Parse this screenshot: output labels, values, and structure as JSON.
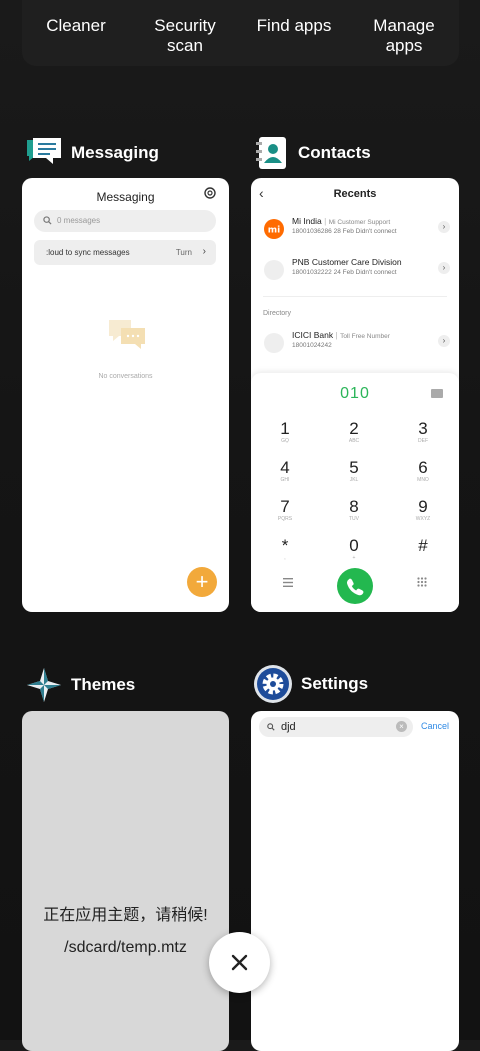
{
  "quick_actions": [
    {
      "label_1": "Cleaner",
      "label_2": ""
    },
    {
      "label_1": "Security",
      "label_2": "scan"
    },
    {
      "label_1": "Find apps",
      "label_2": ""
    },
    {
      "label_1": "Manage",
      "label_2": "apps"
    }
  ],
  "apps": {
    "messaging": {
      "name": "Messaging",
      "screen_title": "Messaging",
      "search_placeholder": "0 messages",
      "sync_text": ":loud to sync messages",
      "sync_action": "Turn",
      "empty_text": "No conversations",
      "fab_label": "+"
    },
    "contacts": {
      "name": "Contacts",
      "back": "‹",
      "screen_title": "Recents",
      "recents": [
        {
          "name": "Mi India",
          "tag": "Mi Customer Support",
          "number": "18001036286",
          "meta": "28 Feb Didn't connect"
        },
        {
          "name": "PNB Customer Care Division",
          "tag": "",
          "number": "18001032222",
          "meta": "24 Feb Didn't connect"
        }
      ],
      "directory_label": "Directory",
      "directory": [
        {
          "name": "ICICI Bank",
          "tag": "Toll Free Number",
          "number": "18001024242"
        }
      ],
      "dial_input": "010",
      "keys": [
        {
          "d": "1",
          "l": "GǪ"
        },
        {
          "d": "2",
          "l": "ABC"
        },
        {
          "d": "3",
          "l": "DEF"
        },
        {
          "d": "4",
          "l": "GHI"
        },
        {
          "d": "5",
          "l": "JKL"
        },
        {
          "d": "6",
          "l": "MNO"
        },
        {
          "d": "7",
          "l": "PQRS"
        },
        {
          "d": "8",
          "l": "TUV"
        },
        {
          "d": "9",
          "l": "WXYZ"
        },
        {
          "d": "*",
          "l": ","
        },
        {
          "d": "0",
          "l": "+"
        },
        {
          "d": "#",
          "l": ""
        }
      ]
    },
    "themes": {
      "name": "Themes",
      "status_line": "正在应用主题，请稍候!",
      "path": "/sdcard/temp.mtz"
    },
    "settings": {
      "name": "Settings",
      "search_value": "djd",
      "cancel_label": "Cancel"
    }
  },
  "colors": {
    "accent_green": "#2bb559",
    "fab_orange": "#f2a93b",
    "link_blue": "#2f8ae5",
    "mi_orange": "#ff6b00"
  }
}
